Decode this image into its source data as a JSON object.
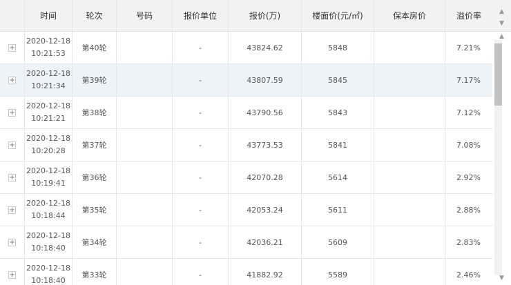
{
  "columns": [
    "",
    "时间",
    "轮次",
    "号码",
    "报价单位",
    "报价(万)",
    "楼面价(元/㎡)",
    "保本房价",
    "溢价率"
  ],
  "rows": [
    {
      "expand": "+",
      "date": "2020-12-18",
      "time": "10:21:53",
      "round": "第40轮",
      "number": "",
      "unit": "-",
      "price": "43824.62",
      "floor_price": "5848",
      "breakeven": "",
      "premium": "7.21%"
    },
    {
      "expand": "+",
      "date": "2020-12-18",
      "time": "10:21:34",
      "round": "第39轮",
      "number": "",
      "unit": "-",
      "price": "43807.59",
      "floor_price": "5845",
      "breakeven": "",
      "premium": "7.17%"
    },
    {
      "expand": "+",
      "date": "2020-12-18",
      "time": "10:21:21",
      "round": "第38轮",
      "number": "",
      "unit": "-",
      "price": "43790.56",
      "floor_price": "5843",
      "breakeven": "",
      "premium": "7.12%"
    },
    {
      "expand": "+",
      "date": "2020-12-18",
      "time": "10:20:28",
      "round": "第37轮",
      "number": "",
      "unit": "-",
      "price": "43773.53",
      "floor_price": "5841",
      "breakeven": "",
      "premium": "7.08%"
    },
    {
      "expand": "+",
      "date": "2020-12-18",
      "time": "10:19:41",
      "round": "第36轮",
      "number": "",
      "unit": "-",
      "price": "42070.28",
      "floor_price": "5614",
      "breakeven": "",
      "premium": "2.92%"
    },
    {
      "expand": "+",
      "date": "2020-12-18",
      "time": "10:18:44",
      "round": "第35轮",
      "number": "",
      "unit": "-",
      "price": "42053.24",
      "floor_price": "5611",
      "breakeven": "",
      "premium": "2.88%"
    },
    {
      "expand": "+",
      "date": "2020-12-18",
      "time": "10:18:40",
      "round": "第34轮",
      "number": "",
      "unit": "-",
      "price": "42036.21",
      "floor_price": "5609",
      "breakeven": "",
      "premium": "2.83%"
    },
    {
      "expand": "+",
      "date": "2020-12-18",
      "time": "10:18:40",
      "round": "第33轮",
      "number": "",
      "unit": "-",
      "price": "41882.92",
      "floor_price": "5589",
      "breakeven": "",
      "premium": "2.46%"
    }
  ],
  "scrollbar": {
    "up_icon": "▲",
    "down_icon": "▼"
  }
}
